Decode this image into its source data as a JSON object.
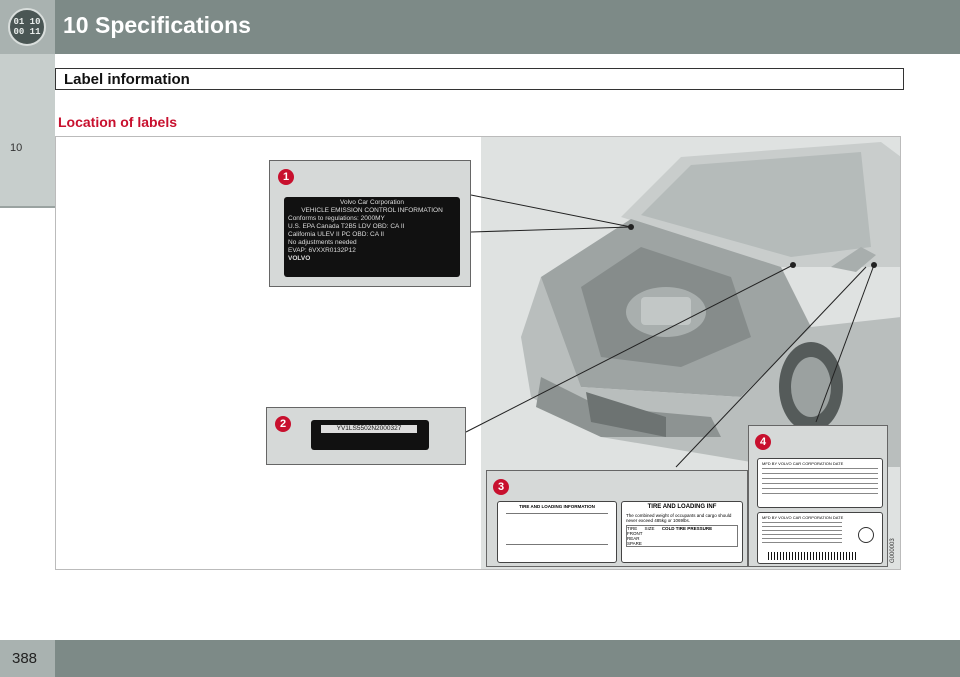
{
  "header": {
    "chapter_badge_lines": [
      "01 10",
      "00 11"
    ],
    "chapter_title": "10  Specifications"
  },
  "sidebar": {
    "chapter_number": "10"
  },
  "section": {
    "title": "Label information"
  },
  "subheading": "Location of labels",
  "figure": {
    "callouts": [
      "1",
      "2",
      "3",
      "4"
    ],
    "label1": {
      "lines": [
        "Volvo Car Corporation",
        "VEHICLE EMISSION CONTROL INFORMATION",
        "Conforms to regulations:   2000MY",
        "U.S. EPA Canada T2B5 LDV   OBD: CA II",
        "California ULEV II PC      OBD: CA II",
        "No adjustments needed",
        "EVAP: 6VXXR0132P12",
        "VOLVO"
      ]
    },
    "label2": {
      "vin": "YV1LS5502N2000327"
    },
    "label3": {
      "left_title": "TIRE AND LOADING INFORMATION",
      "right_title": "TIRE AND LOADING INF",
      "right_note": "The combined weight of occupants and cargo should never exceed 485kg or 1069lbs.",
      "right_table_header": "COLD TIRE PRESSURE",
      "right_cols": [
        "TIRE",
        "SIZE"
      ],
      "right_rows": [
        "FRONT",
        "REAR",
        "SPARE"
      ]
    },
    "label4": {
      "top_text": "MFD BY VOLVO CAR CORPORATION   DATE",
      "bottom_text": "MFD BY VOLVO CAR CORPORATION   DATE"
    },
    "figure_code": "G000003"
  },
  "footer": {
    "page_number": "388"
  },
  "colors": {
    "header": "#7d8a87",
    "accent_red": "#c8102e"
  }
}
